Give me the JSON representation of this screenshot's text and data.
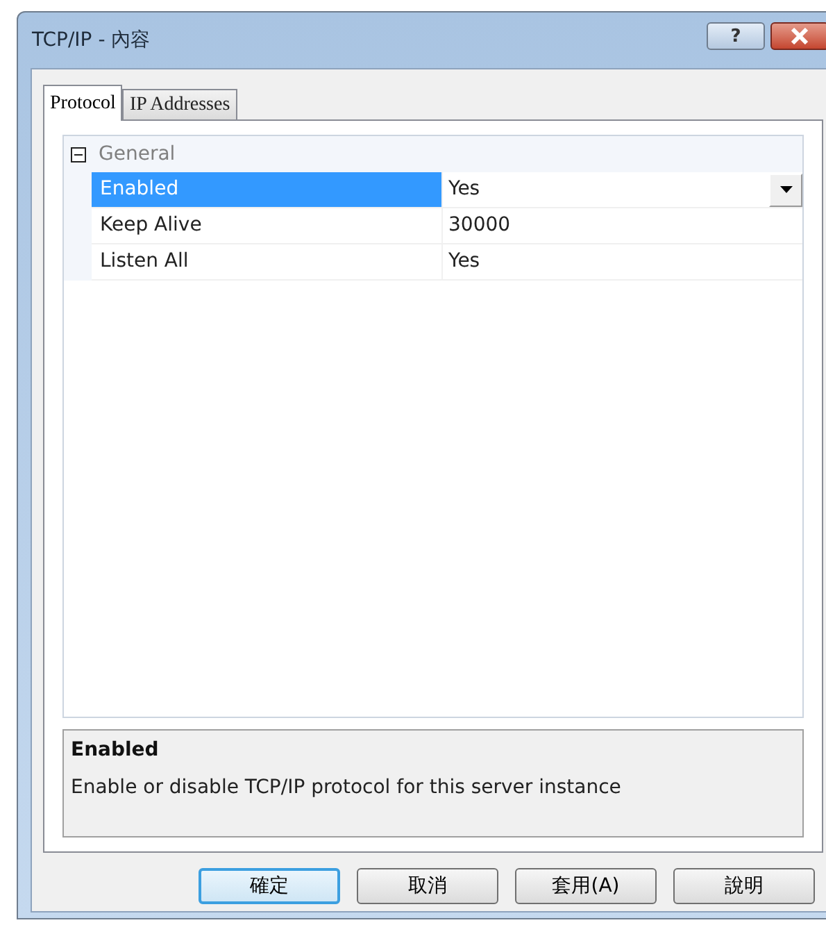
{
  "window": {
    "title": "TCP/IP - 內容",
    "help": "?"
  },
  "tabs": [
    {
      "label": "Protocol",
      "selected": true
    },
    {
      "label": "IP Addresses",
      "selected": false
    }
  ],
  "grid": {
    "category": {
      "label": "General",
      "expanded": true
    },
    "rows": [
      {
        "name": "Enabled",
        "value": "Yes",
        "selected": true
      },
      {
        "name": "Keep Alive",
        "value": "30000",
        "selected": false
      },
      {
        "name": "Listen All",
        "value": "Yes",
        "selected": false
      }
    ]
  },
  "description": {
    "title": "Enabled",
    "text": "Enable or disable TCP/IP protocol for this server instance"
  },
  "buttons": [
    {
      "label": "確定",
      "default": true
    },
    {
      "label": "取消",
      "default": false
    },
    {
      "label": "套用(A)",
      "default": false
    },
    {
      "label": "說明",
      "default": false
    }
  ]
}
